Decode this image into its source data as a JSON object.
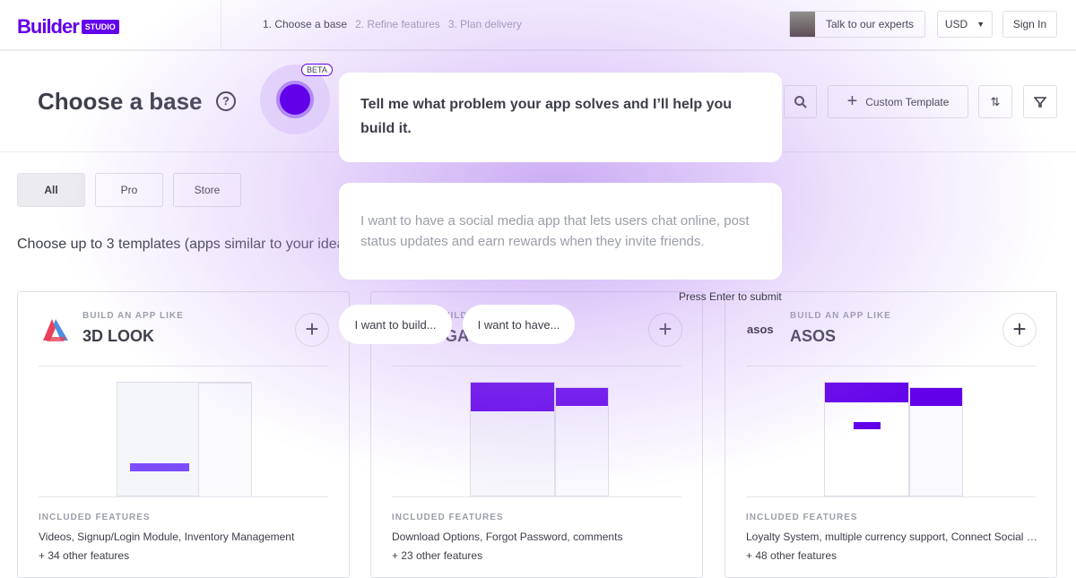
{
  "header": {
    "logo_main": "Builder",
    "logo_badge": "STUDIO",
    "steps": [
      "1. Choose a base",
      "2. Refine features",
      "3. Plan delivery"
    ],
    "experts": "Talk to our experts",
    "currency": "USD",
    "sign_in": "Sign In"
  },
  "title": {
    "text": "Choose a base",
    "help": "?",
    "custom_template": "Custom Template"
  },
  "filters": [
    "All",
    "Pro",
    "Store"
  ],
  "intro": "Choose up to 3 templates (apps similar to your idea",
  "assistant": {
    "beta": "BETA",
    "question": "Tell me what problem your app solves and I’ll help you build it.",
    "answer_placeholder": "I want to have a social media app that lets users chat online, post status updates and earn rewards when they invite friends.",
    "hint": "Press Enter to submit",
    "chips": [
      "I want to build...",
      "I want to have..."
    ]
  },
  "cards": [
    {
      "label": "BUILD AN APP LIKE",
      "name": "3D LOOK",
      "included": "INCLUDED FEATURES",
      "features": "Videos, Signup/Login Module, Inventory Management",
      "more": "+ 34 other features"
    },
    {
      "label": "BUILD AN APP LIKE",
      "name": "9GAG",
      "included": "INCLUDED FEATURES",
      "features": "Download Options, Forgot Password, comments",
      "more": "+ 23 other features"
    },
    {
      "label": "BUILD AN APP LIKE",
      "name": "ASOS",
      "logo_text": "asos",
      "included": "INCLUDED FEATURES",
      "features": "Loyalty System, multiple currency support, Connect Social Media Accounts",
      "more": "+ 48 other features"
    }
  ],
  "colors": {
    "brand": "#6200ea",
    "text": "#3c3e49",
    "muted": "#9b9ea8"
  }
}
